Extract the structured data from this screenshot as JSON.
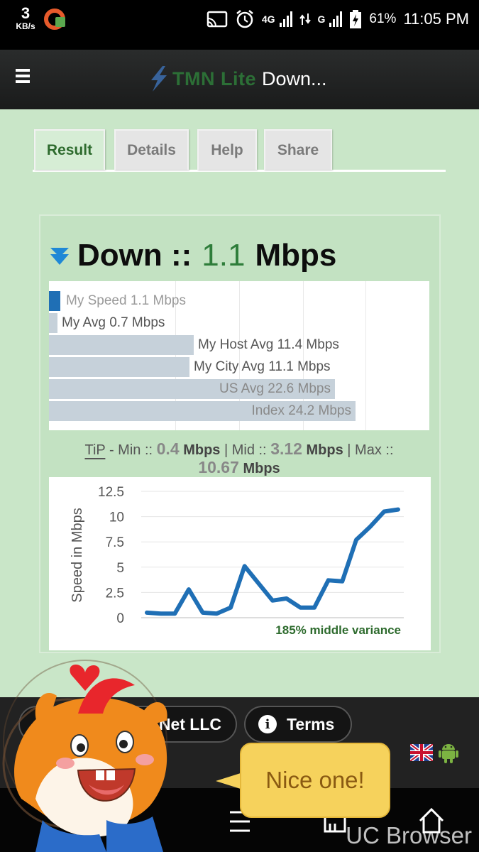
{
  "status_bar": {
    "net_speed": "3",
    "net_speed_unit": "KB/s",
    "network_1": "4G",
    "network_2": "G",
    "battery": "61%",
    "time": "11:05 PM"
  },
  "header": {
    "brand": "TMN Lite",
    "title": "Down..."
  },
  "tabs": [
    {
      "label": "Result",
      "active": true
    },
    {
      "label": "Details",
      "active": false
    },
    {
      "label": "Help",
      "active": false
    },
    {
      "label": "Share",
      "active": false
    }
  ],
  "result": {
    "heading_prefix": "Down ::",
    "speed_value": "1.1",
    "speed_unit": "Mbps"
  },
  "comparison_bars": [
    {
      "label": "My Speed 1.1 Mbps",
      "value": 1.1,
      "color": "#1f6fb5"
    },
    {
      "label": "My Avg 0.7 Mbps",
      "value": 0.7,
      "color": "#c6d1da"
    },
    {
      "label": "My Host Avg 11.4 Mbps",
      "value": 11.4,
      "color": "#c6d1da"
    },
    {
      "label": "My City Avg 11.1 Mbps",
      "value": 11.1,
      "color": "#c6d1da"
    },
    {
      "label": "US Avg 22.6 Mbps",
      "value": 22.6,
      "color": "#c6d1da"
    },
    {
      "label": "Index 24.2 Mbps",
      "value": 24.2,
      "color": "#c6d1da"
    }
  ],
  "tip": {
    "label": "TiP",
    "min_label": "- Min ::",
    "min_value": "0.4",
    "mid_label": "| Mid ::",
    "mid_value": "3.12",
    "max_label": "| Max ::",
    "max_value": "10.67",
    "unit": "Mbps"
  },
  "chart_data": {
    "type": "line",
    "ylabel": "Speed in Mbps",
    "xlabel": "",
    "ylim": [
      0,
      12.5
    ],
    "yticks": [
      "12.5",
      "10",
      "7.5",
      "5",
      "2.5",
      "0"
    ],
    "x": [
      1,
      2,
      3,
      4,
      5,
      6,
      7,
      8,
      9,
      10,
      11,
      12,
      13,
      14,
      15,
      16,
      17,
      18,
      19,
      20
    ],
    "values": [
      0.5,
      0.4,
      0.4,
      2.8,
      0.5,
      0.4,
      1.0,
      5.1,
      3.4,
      1.7,
      1.9,
      1.0,
      1.0,
      3.7,
      3.6,
      7.7,
      9.0,
      10.5,
      10.7
    ],
    "annotation": "185% middle variance",
    "line_color": "#1f6fb5",
    "grid": true
  },
  "footer": {
    "company_fragment": "Net LLC",
    "terms_label": "Terms",
    "info_glyph": "i"
  },
  "overlay": {
    "bubble_text": "Nice one!",
    "watermark": "UC Browser"
  }
}
